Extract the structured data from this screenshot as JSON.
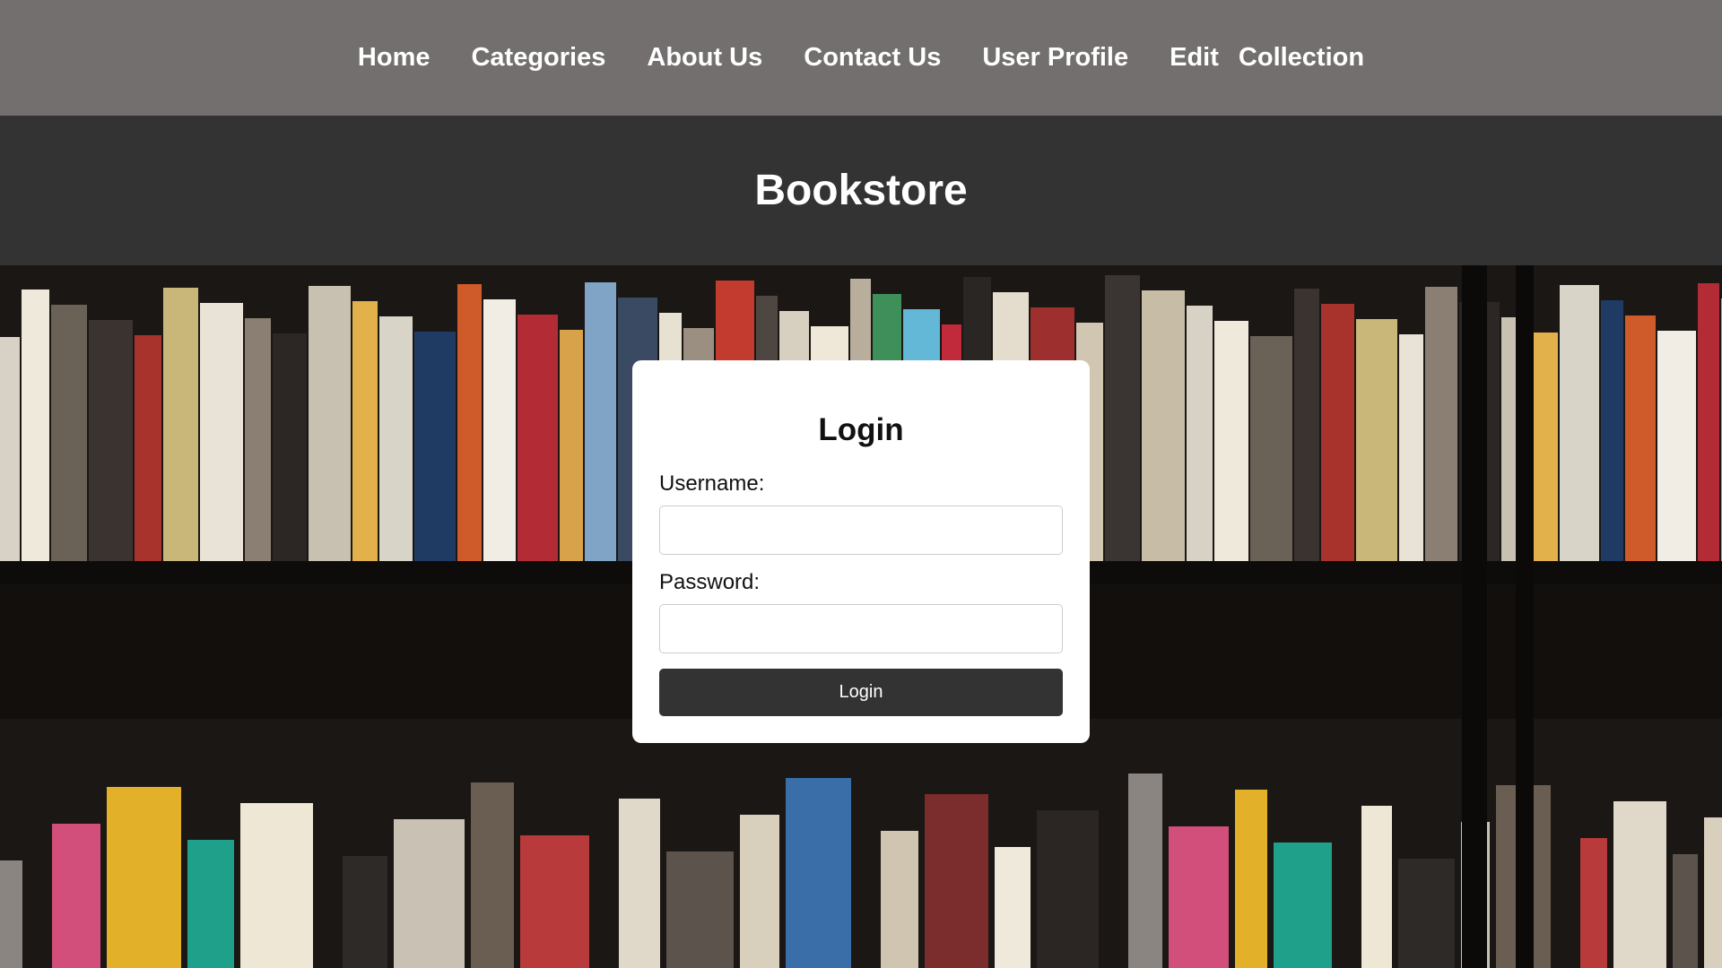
{
  "nav": {
    "home": "Home",
    "categories": "Categories",
    "about": "About Us",
    "contact": "Contact Us",
    "profile": "User Profile",
    "edit": "Edit",
    "collection": "Collection"
  },
  "header": {
    "title": "Bookstore"
  },
  "login": {
    "title": "Login",
    "username_label": "Username:",
    "username_value": "",
    "password_label": "Password:",
    "password_value": "",
    "submit_label": "Login"
  },
  "colors": {
    "nav_bg": "#736f6e",
    "header_bg": "#333333",
    "button_bg": "#333333",
    "card_bg": "#ffffff"
  }
}
